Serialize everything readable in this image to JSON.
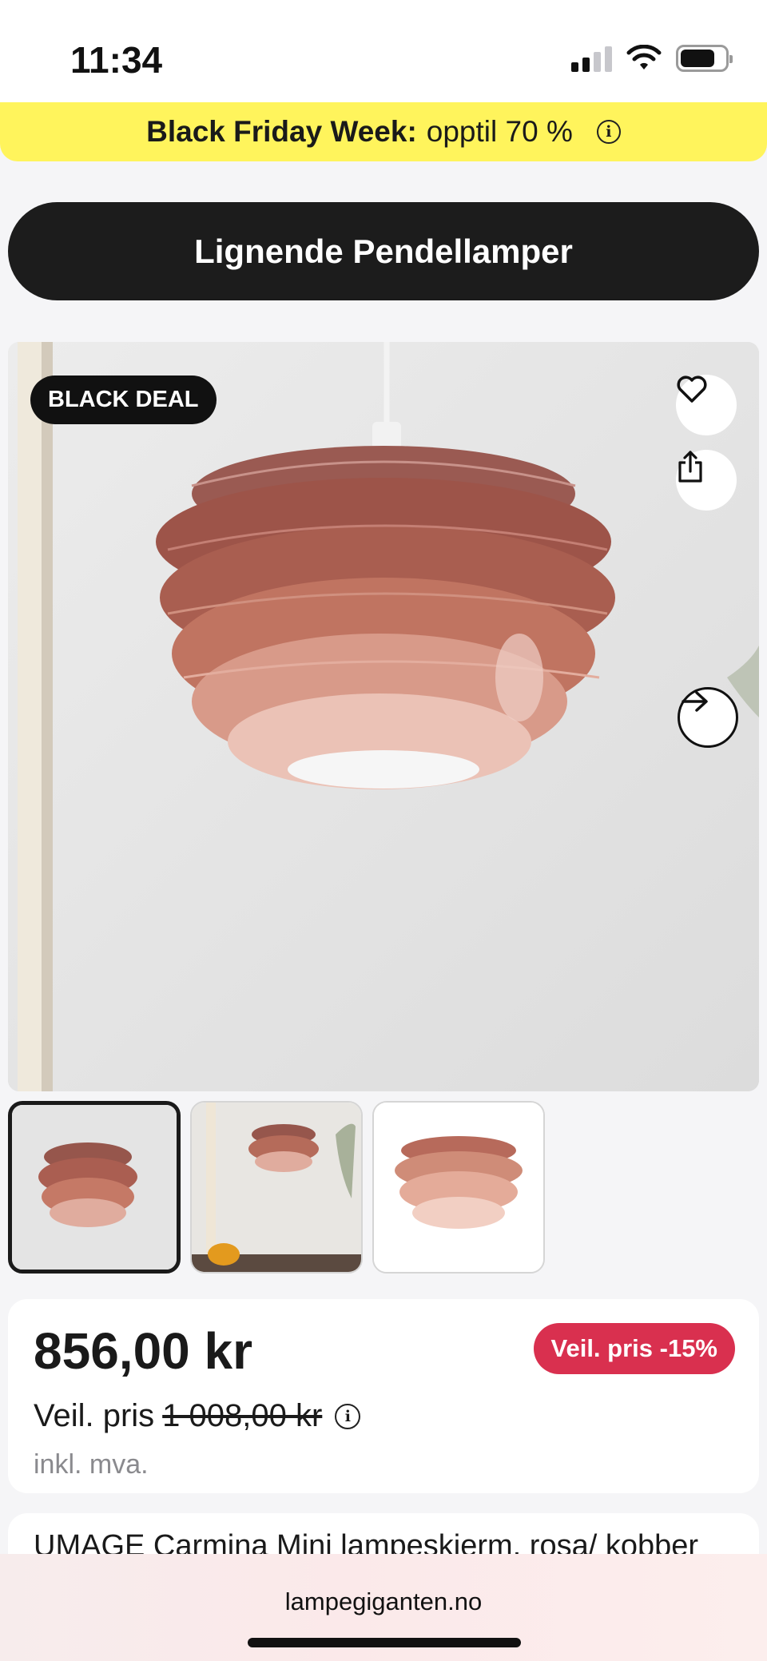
{
  "status_bar": {
    "time": "11:34"
  },
  "promo": {
    "bold_text": "Black Friday Week:",
    "text": "opptil 70 %",
    "info_symbol": "i"
  },
  "similar_button": {
    "label": "Lignende Pendellamper"
  },
  "gallery": {
    "badge": "BLACK DEAL",
    "icons": [
      "heart-icon",
      "share-icon",
      "arrow-right-icon"
    ],
    "thumbnail_count": 3,
    "active_thumbnail": 0
  },
  "price": {
    "current": "856,00 kr",
    "rrp_label": "Veil. pris",
    "rrp_value": "1 008,00 kr",
    "vat_note": "inkl. mva.",
    "discount_badge": "Veil. pris -15%",
    "info_symbol": "i"
  },
  "next_card": {
    "text": "UMAGE Carmina Mini lampeskjerm, rosa/ kobber"
  },
  "browser": {
    "url": "lampegiganten.no"
  },
  "colors": {
    "promo_bg": "#fff45c",
    "dark_button": "#1c1c1c",
    "discount": "#d9304f"
  }
}
